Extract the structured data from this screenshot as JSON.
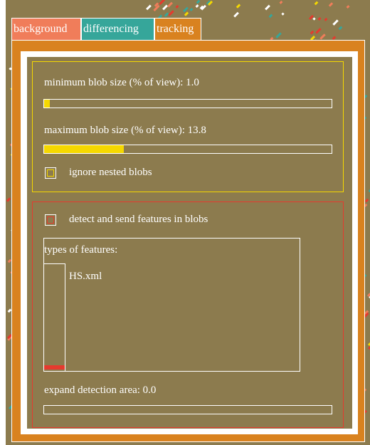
{
  "tabs": [
    {
      "label": "background"
    },
    {
      "label": "differencing"
    },
    {
      "label": "tracking"
    }
  ],
  "active_tab": "tracking",
  "blob_settings": {
    "min_blob_label": "minimum blob size (% of view): 1.0",
    "min_blob_value": 1.0,
    "max_blob_label": "maximum blob size (% of view): 13.8",
    "max_blob_value": 13.8,
    "ignore_nested_label": "ignore nested blobs",
    "ignore_nested_checked": false
  },
  "feature_settings": {
    "detect_label": "detect and send features in blobs",
    "detect_checked": false,
    "types_label": "types of features:",
    "feature_items": [
      "HS.xml"
    ],
    "expand_label": "expand detection area: 0.0",
    "expand_value": 0.0
  },
  "colors": {
    "background_tab": "#f07d5a",
    "differencing_tab": "#36a69a",
    "tracking_tab": "#d9821f",
    "panel_bg": "#8c7b4e",
    "accent_yellow": "#f5d800",
    "accent_red": "#e53a2e"
  }
}
